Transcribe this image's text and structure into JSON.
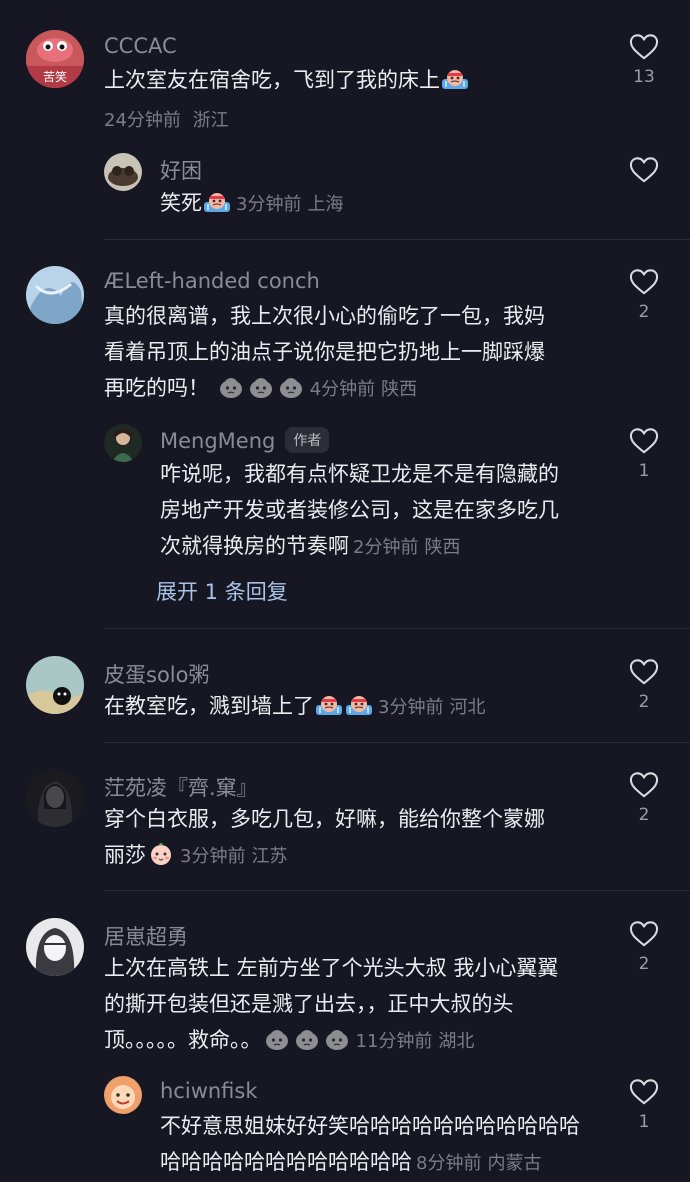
{
  "comments": [
    {
      "user": "CCCAC",
      "avatar_text": "苦笑",
      "text": "上次室友在宿舍吃，飞到了我的床上",
      "time": "24分钟前",
      "location": "浙江",
      "likes": "13",
      "replies": [
        {
          "user": "好困",
          "text": "笑死",
          "time": "3分钟前",
          "location": "上海"
        }
      ]
    },
    {
      "user": "ÆLeft-handed conch",
      "text_lines": [
        "真的很离谱，我上次很小心的偷吃了一包，我妈",
        "看着吊顶上的油点子说你是把它扔地上一脚踩爆",
        "再吃的吗！"
      ],
      "time": "4分钟前",
      "location": "陕西",
      "likes": "2",
      "replies": [
        {
          "user": "MengMeng",
          "tag": "作者",
          "text_lines": [
            "咋说呢，我都有点怀疑卫龙是不是有隐藏的",
            "房地产开发或者装修公司，这是在家多吃几",
            "次就得换房的节奏啊"
          ],
          "time": "2分钟前",
          "location": "陕西",
          "likes": "1"
        }
      ],
      "expand_label": "展开 1 条回复"
    },
    {
      "user": "皮蛋solo粥",
      "text": "在教室吃，溅到墙上了",
      "time": "3分钟前",
      "location": "河北",
      "likes": "2"
    },
    {
      "user": "茳苑凌『齊.窠』",
      "text_lines": [
        "穿个白衣服，多吃几包，好嘛，能给你整个蒙娜",
        "丽莎"
      ],
      "time": "3分钟前",
      "location": "江苏",
      "likes": "2"
    },
    {
      "user": "居崽超勇",
      "text_lines": [
        "上次在高铁上 左前方坐了个光头大叔 我小心翼翼",
        "的撕开包装但还是溅了出去，，正中大叔的头",
        "顶。。。。。救命。。"
      ],
      "time": "11分钟前",
      "location": "湖北",
      "likes": "2",
      "replies": [
        {
          "user": "hciwnfisk",
          "text_lines": [
            "不好意思姐妹好好笑哈哈哈哈哈哈哈哈哈哈哈",
            "哈哈哈哈哈哈哈哈哈哈哈哈"
          ],
          "time": "8分钟前",
          "location": "内蒙古",
          "likes": "1"
        }
      ]
    }
  ],
  "colors": {
    "background": "#161722",
    "text": "#ececf0",
    "muted": "#7b7c86",
    "link": "#a9c2e8"
  }
}
